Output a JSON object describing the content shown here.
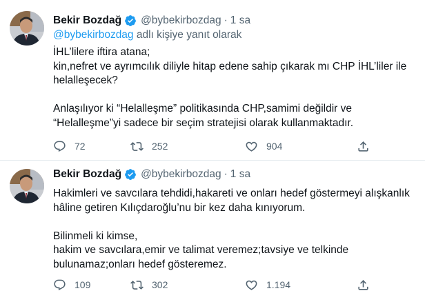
{
  "colors": {
    "text": "#0f1419",
    "muted": "#536471",
    "link": "#1d9bf0",
    "verified": "#1d9bf0",
    "divider": "#e6ecf0"
  },
  "tweets": [
    {
      "author": "Bekir Bozdağ",
      "handle": "@bybekirbozdag",
      "separator": "·",
      "time": "1 sa",
      "reply_to_handle": "@bybekirbozdag",
      "reply_to_suffix": " adlı kişiye yanıt olarak",
      "paragraphs": [
        "İHL’lilere iftira atana;\nkin,nefret ve ayrımcılık diliyle hitap edene sahip çıkarak mı CHP İHL’liler ile helalleşecek?",
        "Anlaşılıyor ki “Helalleşme” politikasında CHP,samimi değildir ve “Helalleşme”yi sadece bir seçim stratejisi olarak kullanmaktadır."
      ],
      "replies": "72",
      "retweets": "252",
      "likes": "904"
    },
    {
      "author": "Bekir Bozdağ",
      "handle": "@bybekirbozdag",
      "separator": "·",
      "time": "1 sa",
      "paragraphs": [
        "Hakimleri ve savcılara tehdidi,hakareti ve onları hedef göstermeyi alışkanlık hâline getiren Kılıçdaroğlu’nu bir kez daha kınıyorum.",
        "Bilinmeli ki kimse,\nhakim ve savcılara,emir ve talimat veremez;tavsiye ve telkinde bulunamaz;onları hedef gösteremez."
      ],
      "replies": "109",
      "retweets": "302",
      "likes": "1.194"
    }
  ],
  "icons": {
    "avatar": "profile-photo",
    "verified": "verified-badge-icon",
    "reply": "reply-bubble-icon",
    "retweet": "retweet-icon",
    "like": "heart-icon",
    "share": "share-icon"
  }
}
